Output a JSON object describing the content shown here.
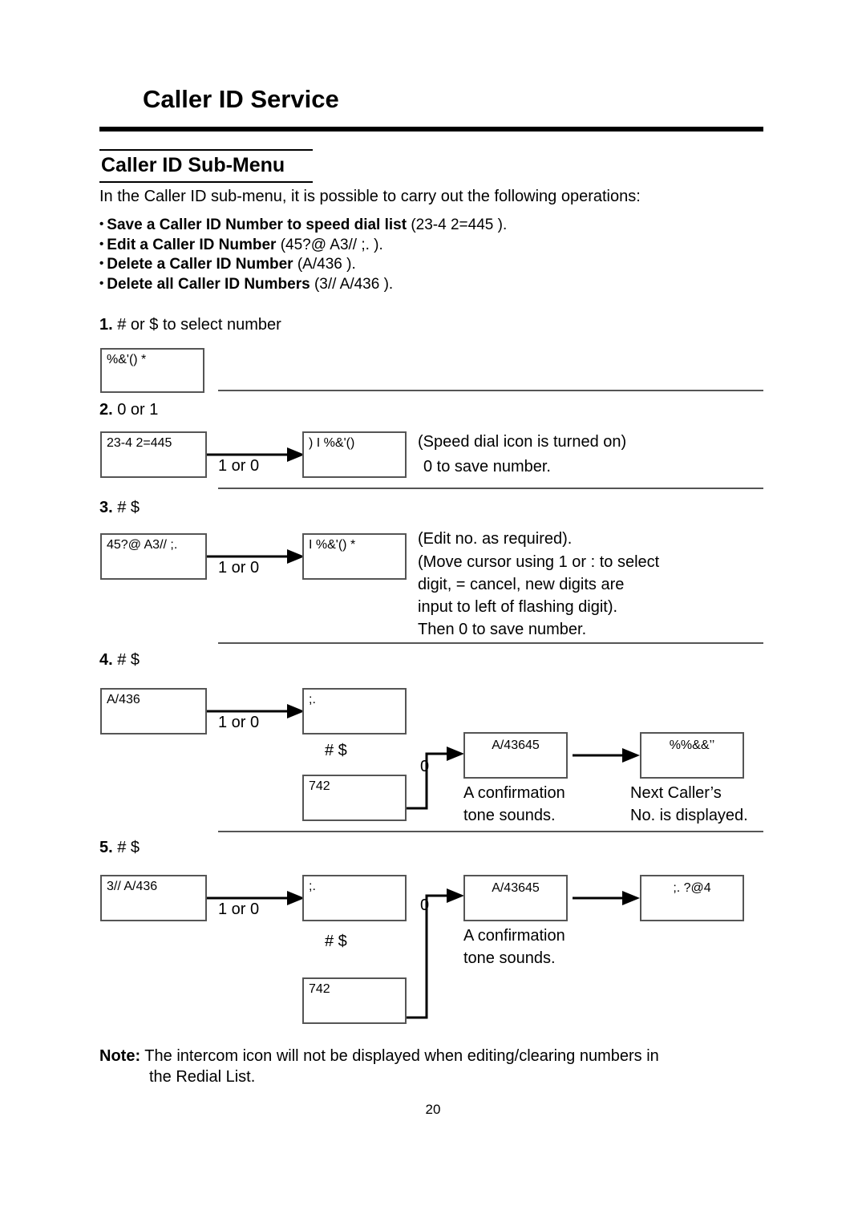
{
  "header": {
    "title": "Caller ID Service",
    "section_title": "Caller ID Sub-Menu",
    "intro": "In the Caller ID sub-menu, it is possible to carry out the following operations:"
  },
  "bullets": [
    {
      "label": "Save a Caller ID Number to speed dial list",
      "lcd": "(23-4 2=445  )."
    },
    {
      "label": "Edit a Caller ID Number",
      "lcd": "(45?@ A3// ;.   )."
    },
    {
      "label": "Delete a Caller ID Number",
      "lcd": "(A/436 )."
    },
    {
      "label": "Delete all Caller ID Numbers",
      "lcd": "(3// A/436   )."
    }
  ],
  "steps": {
    "step1": {
      "number": "1.",
      "text": "#       or $  to select number",
      "box1": "%&'() *"
    },
    "step2": {
      "number": "2.",
      "text": "0        or 1",
      "box1": "23-4 2=445",
      "box2": ") I %&'()",
      "connector_label": "1  or 0",
      "note1": "(Speed dial icon is turned on)",
      "note2": "0        to save number."
    },
    "step3": {
      "number": "3.",
      "text": "# $",
      "box1": "45?@ A3// ;.",
      "box2": "I  %&'() *",
      "connector_label": "1  or 0",
      "notes": [
        "(Edit no. as required).",
        "(Move cursor using 1  or :   to select",
        "digit,        = cancel, new digits are",
        "input to left of flashing digit).",
        "Then  0       to save number."
      ]
    },
    "step4": {
      "number": "4.",
      "text": "# $",
      "box1": "A/436",
      "box2": ";.",
      "box3": "742",
      "box4": "A/43645",
      "box5": "%%&&’’",
      "connector_label": "1  or 0",
      "branch_label": "# $",
      "merge_label": "0",
      "note1_line1": "A confirmation",
      "note1_line2": "tone sounds.",
      "note2_line1": "Next Caller’s",
      "note2_line2": "No. is displayed."
    },
    "step5": {
      "number": "5.",
      "text": "# $",
      "box1": "3// A/436",
      "box2": ";.",
      "box3": "742",
      "box4": "A/43645",
      "box5": ";. ?@4",
      "connector_label": "1  or 0",
      "branch_label": "# $",
      "merge_label": "0",
      "note1_line1": "A confirmation",
      "note1_line2": "tone sounds."
    }
  },
  "footer": {
    "note_label": "Note:",
    "note_line1": " The intercom icon will not be displayed when editing/clearing numbers in",
    "note_line2": "the Redial List.",
    "page_number": "20"
  }
}
